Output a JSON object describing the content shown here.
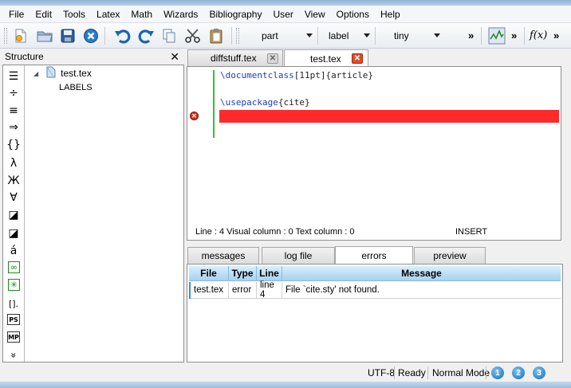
{
  "menu": [
    "File",
    "Edit",
    "Tools",
    "Latex",
    "Math",
    "Wizards",
    "Bibliography",
    "User",
    "View",
    "Options",
    "Help"
  ],
  "toolbar": {
    "buttons": [
      "new-file-icon",
      "open-icon",
      "save-icon",
      "close-icon",
      "undo-icon",
      "redo-icon",
      "copy-icon",
      "cut-icon",
      "paste-icon"
    ],
    "combo_section": "part",
    "combo_label": "label",
    "combo_size": "tiny",
    "more": "»",
    "fx_label": "f(x)",
    "more2": "»",
    "more3": "»"
  },
  "structure": {
    "title": "Structure",
    "close": "✕",
    "tree_file": "test.tex",
    "tree_child": "LABELS",
    "expander": "◢",
    "symbols": [
      "☰",
      "÷",
      "≡",
      "⇒",
      "{}",
      "λ",
      "Ж",
      "∀",
      "◪",
      "◪",
      "á",
      "∞",
      "✳",
      "[].",
      "PS",
      "MP",
      "»"
    ]
  },
  "editor_tabs": [
    {
      "label": "diffstuff.tex",
      "close": "✕"
    },
    {
      "label": "test.tex",
      "close": "✕"
    }
  ],
  "editor": {
    "line1_cmd": "\\documentclass",
    "line1_rest": "[11pt]{article}",
    "line3_cmd": "\\usepackage",
    "line3_rest": "{cite}",
    "error_mark": "✕",
    "status": "Line : 4 Visual column : 0 Text column : 0",
    "mode": "INSERT"
  },
  "output_tabs": [
    "messages",
    "log file",
    "errors",
    "preview"
  ],
  "output": {
    "headers": [
      "File",
      "Type",
      "Line",
      "Message"
    ],
    "row": {
      "file": "test.tex",
      "type": "error",
      "line": "line 4",
      "message": "File `cite.sty' not found."
    }
  },
  "statusbar": {
    "encoding": "UTF-8",
    "state": "Ready",
    "mode": "Normal Mode",
    "circles": [
      "1",
      "2",
      "3"
    ]
  },
  "colors": {
    "error_highlight": "#ff2a2a",
    "keyword": "#1c3dbf",
    "gutter_change": "#2fc42f",
    "tab_close_red": "#e04b2b"
  }
}
